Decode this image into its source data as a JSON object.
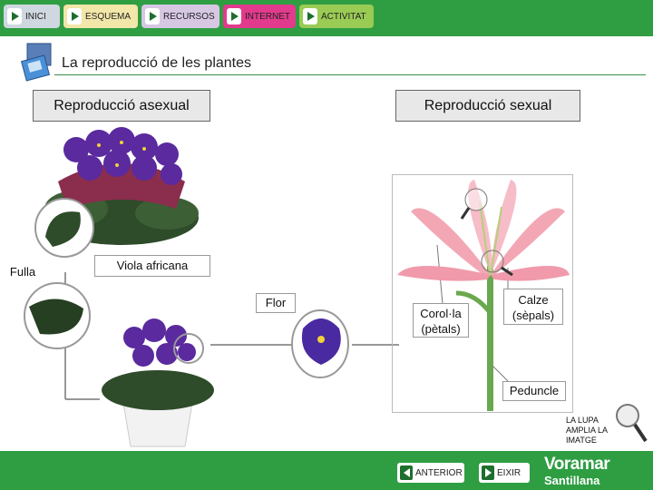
{
  "nav": {
    "items": [
      {
        "label": "INICI",
        "color": "#cfd7e0"
      },
      {
        "label": "ESQUEMA",
        "color": "#f2e6a8"
      },
      {
        "label": "RECURSOS",
        "color": "#d6c7e3"
      },
      {
        "label": "INTERNET",
        "color": "#e23a8d"
      },
      {
        "label": "ACTIVITAT",
        "color": "#9acb54"
      }
    ]
  },
  "page": {
    "title": "La reproducció de les plantes"
  },
  "boxes": {
    "asexual": "Reproducció asexual",
    "sexual": "Reproducció sexual"
  },
  "labels": {
    "viola": "Viola africana",
    "fulla": "Fulla",
    "flor": "Flor",
    "corola": "Corol·la (pètals)",
    "calze": "Calze (sèpals)",
    "peduncle": "Peduncle"
  },
  "lupa": {
    "text": "LA LUPA AMPLIA LA IMATGE"
  },
  "footer": {
    "prev": "ANTERIOR",
    "exit": "EIXIR",
    "brand1": "Voramar",
    "brand2": "Santillana"
  },
  "colors": {
    "bar": "#2f9e43",
    "petal": "#5a2a9e",
    "lily": "#f3a7b5",
    "leaf": "#2e4b2a"
  }
}
